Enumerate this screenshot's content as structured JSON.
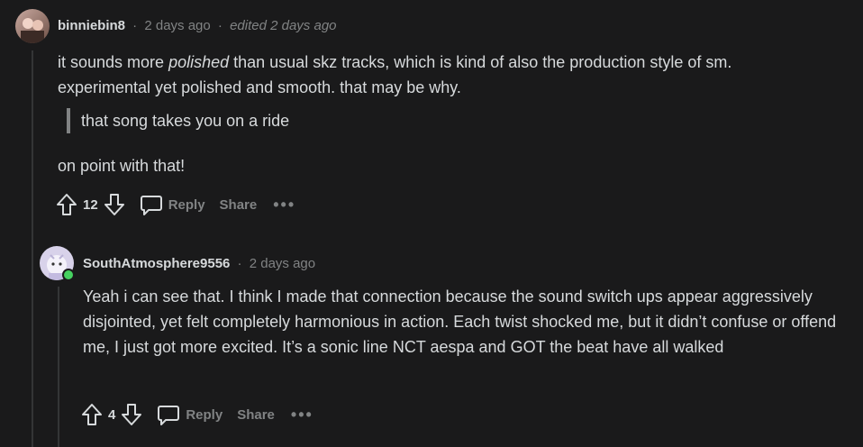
{
  "comment1": {
    "username": "binniebin8",
    "separator1": "·",
    "time": "2 days ago",
    "separator2": "·",
    "edited": "edited 2 days ago",
    "line1_before": "it sounds more ",
    "line1_italic": "polished",
    "line1_after": " than usual skz tracks, which is kind of also the production style of sm.",
    "line2": "experimental yet polished and smooth. that may be why.",
    "quote": "that song takes you on a ride",
    "line3": "on point with that!",
    "votes": "12",
    "reply_label": "Reply",
    "share_label": "Share",
    "more_label": "•••"
  },
  "comment2": {
    "username": "SouthAtmosphere9556",
    "separator1": "·",
    "time": "2 days ago",
    "text": "Yeah i can see that. I think I made that connection because the sound switch ups appear aggressively disjointed, yet felt completely harmonious in action. Each twist shocked me, but it didn’t confuse or offend me, I just got more excited. It’s a sonic line NCT aespa and GOT the beat have all walked",
    "votes": "4",
    "reply_label": "Reply",
    "share_label": "Share",
    "more_label": "•••"
  },
  "colors": {
    "background": "#1a1a1b",
    "text": "#d7dadc",
    "muted": "#818384",
    "online": "#46d160"
  }
}
